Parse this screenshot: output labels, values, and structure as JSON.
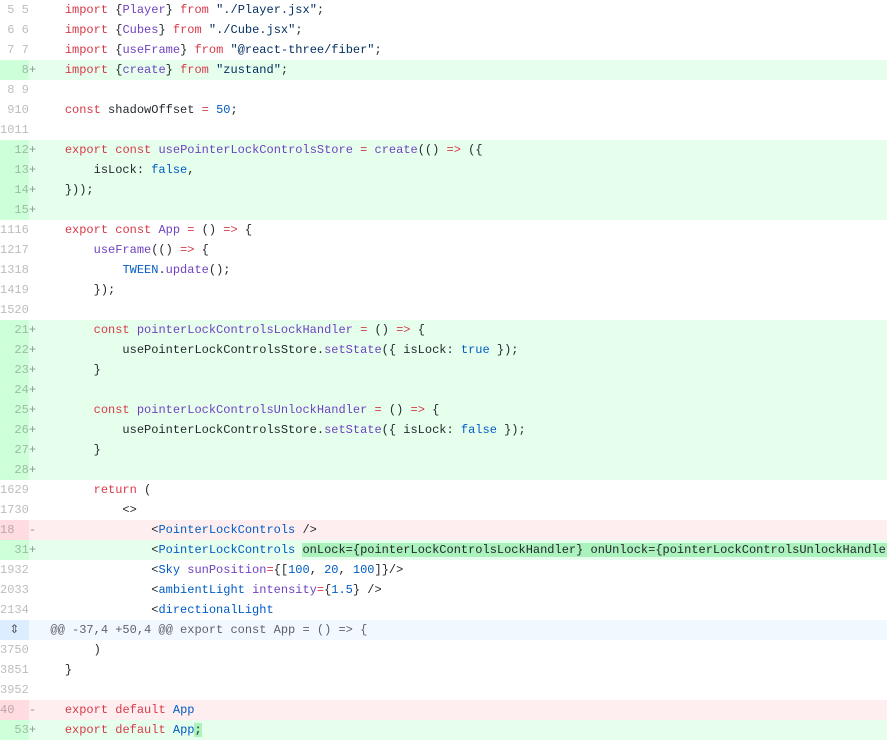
{
  "hunk_header": "@@ -37,4 +50,4 @@ export const App = () => {",
  "expand_icon": "⇕",
  "lines": [
    {
      "old": "5",
      "new": "5",
      "type": "context",
      "sign": "",
      "tokens": [
        {
          "t": "    ",
          "c": "pl"
        },
        {
          "t": "import",
          "c": "kw"
        },
        {
          "t": " {",
          "c": "pl"
        },
        {
          "t": "Player",
          "c": "fn"
        },
        {
          "t": "} ",
          "c": "pl"
        },
        {
          "t": "from",
          "c": "kw"
        },
        {
          "t": " ",
          "c": "pl"
        },
        {
          "t": "\"./Player.jsx\"",
          "c": "str"
        },
        {
          "t": ";",
          "c": "pl"
        }
      ]
    },
    {
      "old": "6",
      "new": "6",
      "type": "context",
      "sign": "",
      "tokens": [
        {
          "t": "    ",
          "c": "pl"
        },
        {
          "t": "import",
          "c": "kw"
        },
        {
          "t": " {",
          "c": "pl"
        },
        {
          "t": "Cubes",
          "c": "fn"
        },
        {
          "t": "} ",
          "c": "pl"
        },
        {
          "t": "from",
          "c": "kw"
        },
        {
          "t": " ",
          "c": "pl"
        },
        {
          "t": "\"./Cube.jsx\"",
          "c": "str"
        },
        {
          "t": ";",
          "c": "pl"
        }
      ]
    },
    {
      "old": "7",
      "new": "7",
      "type": "context",
      "sign": "",
      "tokens": [
        {
          "t": "    ",
          "c": "pl"
        },
        {
          "t": "import",
          "c": "kw"
        },
        {
          "t": " {",
          "c": "pl"
        },
        {
          "t": "useFrame",
          "c": "fn"
        },
        {
          "t": "} ",
          "c": "pl"
        },
        {
          "t": "from",
          "c": "kw"
        },
        {
          "t": " ",
          "c": "pl"
        },
        {
          "t": "\"@react-three/fiber\"",
          "c": "str"
        },
        {
          "t": ";",
          "c": "pl"
        }
      ]
    },
    {
      "old": "",
      "new": "8",
      "type": "addition",
      "sign": "+",
      "tokens": [
        {
          "t": "    ",
          "c": "pl"
        },
        {
          "t": "import",
          "c": "kw"
        },
        {
          "t": " {",
          "c": "pl"
        },
        {
          "t": "create",
          "c": "fn"
        },
        {
          "t": "} ",
          "c": "pl"
        },
        {
          "t": "from",
          "c": "kw"
        },
        {
          "t": " ",
          "c": "pl"
        },
        {
          "t": "\"zustand\"",
          "c": "str"
        },
        {
          "t": ";",
          "c": "pl"
        }
      ]
    },
    {
      "old": "8",
      "new": "9",
      "type": "context",
      "sign": "",
      "tokens": []
    },
    {
      "old": "9",
      "new": "10",
      "type": "context",
      "sign": "",
      "tokens": [
        {
          "t": "    ",
          "c": "pl"
        },
        {
          "t": "const",
          "c": "kw"
        },
        {
          "t": " shadowOffset ",
          "c": "pl"
        },
        {
          "t": "=",
          "c": "kw"
        },
        {
          "t": " ",
          "c": "pl"
        },
        {
          "t": "50",
          "c": "num"
        },
        {
          "t": ";",
          "c": "pl"
        }
      ]
    },
    {
      "old": "10",
      "new": "11",
      "type": "context",
      "sign": "",
      "tokens": []
    },
    {
      "old": "",
      "new": "12",
      "type": "addition",
      "sign": "+",
      "tokens": [
        {
          "t": "    ",
          "c": "pl"
        },
        {
          "t": "export",
          "c": "kw"
        },
        {
          "t": " ",
          "c": "pl"
        },
        {
          "t": "const",
          "c": "kw"
        },
        {
          "t": " ",
          "c": "pl"
        },
        {
          "t": "usePointerLockControlsStore",
          "c": "fn"
        },
        {
          "t": " ",
          "c": "pl"
        },
        {
          "t": "=",
          "c": "kw"
        },
        {
          "t": " ",
          "c": "pl"
        },
        {
          "t": "create",
          "c": "fn"
        },
        {
          "t": "(() ",
          "c": "pl"
        },
        {
          "t": "=>",
          "c": "kw"
        },
        {
          "t": " ({",
          "c": "pl"
        }
      ]
    },
    {
      "old": "",
      "new": "13",
      "type": "addition",
      "sign": "+",
      "tokens": [
        {
          "t": "        isLock: ",
          "c": "pl"
        },
        {
          "t": "false",
          "c": "const"
        },
        {
          "t": ",",
          "c": "pl"
        }
      ]
    },
    {
      "old": "",
      "new": "14",
      "type": "addition",
      "sign": "+",
      "tokens": [
        {
          "t": "    }));",
          "c": "pl"
        }
      ]
    },
    {
      "old": "",
      "new": "15",
      "type": "addition",
      "sign": "+",
      "tokens": []
    },
    {
      "old": "11",
      "new": "16",
      "type": "context",
      "sign": "",
      "tokens": [
        {
          "t": "    ",
          "c": "pl"
        },
        {
          "t": "export",
          "c": "kw"
        },
        {
          "t": " ",
          "c": "pl"
        },
        {
          "t": "const",
          "c": "kw"
        },
        {
          "t": " ",
          "c": "pl"
        },
        {
          "t": "App",
          "c": "fn"
        },
        {
          "t": " ",
          "c": "pl"
        },
        {
          "t": "=",
          "c": "kw"
        },
        {
          "t": " () ",
          "c": "pl"
        },
        {
          "t": "=>",
          "c": "kw"
        },
        {
          "t": " {",
          "c": "pl"
        }
      ]
    },
    {
      "old": "12",
      "new": "17",
      "type": "context",
      "sign": "",
      "tokens": [
        {
          "t": "        ",
          "c": "pl"
        },
        {
          "t": "useFrame",
          "c": "fn"
        },
        {
          "t": "(() ",
          "c": "pl"
        },
        {
          "t": "=>",
          "c": "kw"
        },
        {
          "t": " {",
          "c": "pl"
        }
      ]
    },
    {
      "old": "13",
      "new": "18",
      "type": "context",
      "sign": "",
      "tokens": [
        {
          "t": "            ",
          "c": "pl"
        },
        {
          "t": "TWEEN",
          "c": "const"
        },
        {
          "t": ".",
          "c": "pl"
        },
        {
          "t": "update",
          "c": "fn"
        },
        {
          "t": "();",
          "c": "pl"
        }
      ]
    },
    {
      "old": "14",
      "new": "19",
      "type": "context",
      "sign": "",
      "tokens": [
        {
          "t": "        });",
          "c": "pl"
        }
      ]
    },
    {
      "old": "15",
      "new": "20",
      "type": "context",
      "sign": "",
      "tokens": []
    },
    {
      "old": "",
      "new": "21",
      "type": "addition",
      "sign": "+",
      "tokens": [
        {
          "t": "        ",
          "c": "pl"
        },
        {
          "t": "const",
          "c": "kw"
        },
        {
          "t": " ",
          "c": "pl"
        },
        {
          "t": "pointerLockControlsLockHandler",
          "c": "fn"
        },
        {
          "t": " ",
          "c": "pl"
        },
        {
          "t": "=",
          "c": "kw"
        },
        {
          "t": " () ",
          "c": "pl"
        },
        {
          "t": "=>",
          "c": "kw"
        },
        {
          "t": " {",
          "c": "pl"
        }
      ]
    },
    {
      "old": "",
      "new": "22",
      "type": "addition",
      "sign": "+",
      "tokens": [
        {
          "t": "            usePointerLockControlsStore.",
          "c": "pl"
        },
        {
          "t": "setState",
          "c": "fn"
        },
        {
          "t": "({ isLock: ",
          "c": "pl"
        },
        {
          "t": "true",
          "c": "const"
        },
        {
          "t": " });",
          "c": "pl"
        }
      ]
    },
    {
      "old": "",
      "new": "23",
      "type": "addition",
      "sign": "+",
      "tokens": [
        {
          "t": "        }",
          "c": "pl"
        }
      ]
    },
    {
      "old": "",
      "new": "24",
      "type": "addition",
      "sign": "+",
      "tokens": []
    },
    {
      "old": "",
      "new": "25",
      "type": "addition",
      "sign": "+",
      "tokens": [
        {
          "t": "        ",
          "c": "pl"
        },
        {
          "t": "const",
          "c": "kw"
        },
        {
          "t": " ",
          "c": "pl"
        },
        {
          "t": "pointerLockControlsUnlockHandler",
          "c": "fn"
        },
        {
          "t": " ",
          "c": "pl"
        },
        {
          "t": "=",
          "c": "kw"
        },
        {
          "t": " () ",
          "c": "pl"
        },
        {
          "t": "=>",
          "c": "kw"
        },
        {
          "t": " {",
          "c": "pl"
        }
      ]
    },
    {
      "old": "",
      "new": "26",
      "type": "addition",
      "sign": "+",
      "tokens": [
        {
          "t": "            usePointerLockControlsStore.",
          "c": "pl"
        },
        {
          "t": "setState",
          "c": "fn"
        },
        {
          "t": "({ isLock: ",
          "c": "pl"
        },
        {
          "t": "false",
          "c": "const"
        },
        {
          "t": " });",
          "c": "pl"
        }
      ]
    },
    {
      "old": "",
      "new": "27",
      "type": "addition",
      "sign": "+",
      "tokens": [
        {
          "t": "        }",
          "c": "pl"
        }
      ]
    },
    {
      "old": "",
      "new": "28",
      "type": "addition",
      "sign": "+",
      "tokens": []
    },
    {
      "old": "16",
      "new": "29",
      "type": "context",
      "sign": "",
      "tokens": [
        {
          "t": "        ",
          "c": "pl"
        },
        {
          "t": "return",
          "c": "kw"
        },
        {
          "t": " (",
          "c": "pl"
        }
      ]
    },
    {
      "old": "17",
      "new": "30",
      "type": "context",
      "sign": "",
      "tokens": [
        {
          "t": "            <>",
          "c": "pl"
        }
      ]
    },
    {
      "old": "18",
      "new": "",
      "type": "deletion",
      "sign": "-",
      "tokens": [
        {
          "t": "                <",
          "c": "pl"
        },
        {
          "t": "PointerLockControls",
          "c": "const"
        },
        {
          "t": " />",
          "c": "pl"
        }
      ]
    },
    {
      "old": "",
      "new": "31",
      "type": "addition",
      "sign": "+",
      "tokens": [
        {
          "t": "                <",
          "c": "pl"
        },
        {
          "t": "PointerLockControls",
          "c": "const"
        },
        {
          "t": " ",
          "c": "pl"
        },
        {
          "t": "onLock={pointerLockControlsLockHandler} onUnlock={pointerLockControlsUnlockHandler}",
          "c": "pl",
          "hl": "hl-green"
        },
        {
          "t": " />",
          "c": "pl"
        }
      ]
    },
    {
      "old": "19",
      "new": "32",
      "type": "context",
      "sign": "",
      "tokens": [
        {
          "t": "                <",
          "c": "pl"
        },
        {
          "t": "Sky",
          "c": "const"
        },
        {
          "t": " ",
          "c": "pl"
        },
        {
          "t": "sunPosition",
          "c": "fn"
        },
        {
          "t": "=",
          "c": "kw"
        },
        {
          "t": "{[",
          "c": "pl"
        },
        {
          "t": "100",
          "c": "num"
        },
        {
          "t": ", ",
          "c": "pl"
        },
        {
          "t": "20",
          "c": "num"
        },
        {
          "t": ", ",
          "c": "pl"
        },
        {
          "t": "100",
          "c": "num"
        },
        {
          "t": "]}/>",
          "c": "pl"
        }
      ]
    },
    {
      "old": "20",
      "new": "33",
      "type": "context",
      "sign": "",
      "tokens": [
        {
          "t": "                <",
          "c": "pl"
        },
        {
          "t": "ambientLight",
          "c": "const"
        },
        {
          "t": " ",
          "c": "pl"
        },
        {
          "t": "intensity",
          "c": "fn"
        },
        {
          "t": "=",
          "c": "kw"
        },
        {
          "t": "{",
          "c": "pl"
        },
        {
          "t": "1.5",
          "c": "num"
        },
        {
          "t": "} />",
          "c": "pl"
        }
      ]
    },
    {
      "old": "21",
      "new": "34",
      "type": "context",
      "sign": "",
      "tokens": [
        {
          "t": "                <",
          "c": "pl"
        },
        {
          "t": "directionalLight",
          "c": "const"
        }
      ]
    },
    {
      "type": "hunk"
    },
    {
      "old": "37",
      "new": "50",
      "type": "context",
      "sign": "",
      "tokens": [
        {
          "t": "        )",
          "c": "pl"
        }
      ]
    },
    {
      "old": "38",
      "new": "51",
      "type": "context",
      "sign": "",
      "tokens": [
        {
          "t": "    }",
          "c": "pl"
        }
      ]
    },
    {
      "old": "39",
      "new": "52",
      "type": "context",
      "sign": "",
      "tokens": []
    },
    {
      "old": "40",
      "new": "",
      "type": "deletion",
      "sign": "-",
      "tokens": [
        {
          "t": "    ",
          "c": "pl"
        },
        {
          "t": "export",
          "c": "kw"
        },
        {
          "t": " ",
          "c": "pl"
        },
        {
          "t": "default",
          "c": "kw"
        },
        {
          "t": " ",
          "c": "pl"
        },
        {
          "t": "App",
          "c": "const"
        }
      ]
    },
    {
      "old": "",
      "new": "53",
      "type": "addition",
      "sign": "+",
      "tokens": [
        {
          "t": "    ",
          "c": "pl"
        },
        {
          "t": "export",
          "c": "kw"
        },
        {
          "t": " ",
          "c": "pl"
        },
        {
          "t": "default",
          "c": "kw"
        },
        {
          "t": " ",
          "c": "pl"
        },
        {
          "t": "App",
          "c": "const"
        },
        {
          "t": ";",
          "c": "pl",
          "hl": "hl-green"
        }
      ]
    }
  ]
}
